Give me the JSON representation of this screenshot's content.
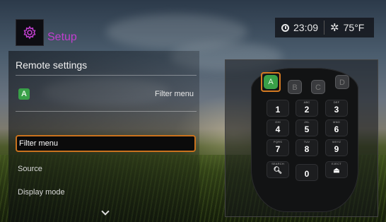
{
  "header": {
    "title": "Setup",
    "icon": "gear-icon",
    "clock": "23:09",
    "temperature": "75°F",
    "weather_icon": "sun-icon",
    "accent_color": "#c13fcf"
  },
  "left_panel": {
    "title": "Remote settings",
    "active_key_label": "A",
    "active_key_function": "Filter menu",
    "menu_items": [
      "Filter menu",
      "Source",
      "Display mode"
    ],
    "selected_index": 0
  },
  "remote": {
    "color_keys": [
      "A",
      "B",
      "C",
      "D"
    ],
    "active_color_key": "A",
    "keys": [
      {
        "sub": "",
        "digit": "1"
      },
      {
        "sub": "ABC",
        "digit": "2"
      },
      {
        "sub": "DEF",
        "digit": "3"
      },
      {
        "sub": "GHI",
        "digit": "4"
      },
      {
        "sub": "JKL",
        "digit": "5"
      },
      {
        "sub": "MNO",
        "digit": "6"
      },
      {
        "sub": "PQRS",
        "digit": "7"
      },
      {
        "sub": "TUV",
        "digit": "8"
      },
      {
        "sub": "WXYZ",
        "digit": "9"
      },
      {
        "sub": "SEARCH",
        "digit": "🔍︎"
      },
      {
        "sub": "",
        "digit": "0"
      },
      {
        "sub": "EJECT",
        "digit": "⏏"
      }
    ]
  }
}
